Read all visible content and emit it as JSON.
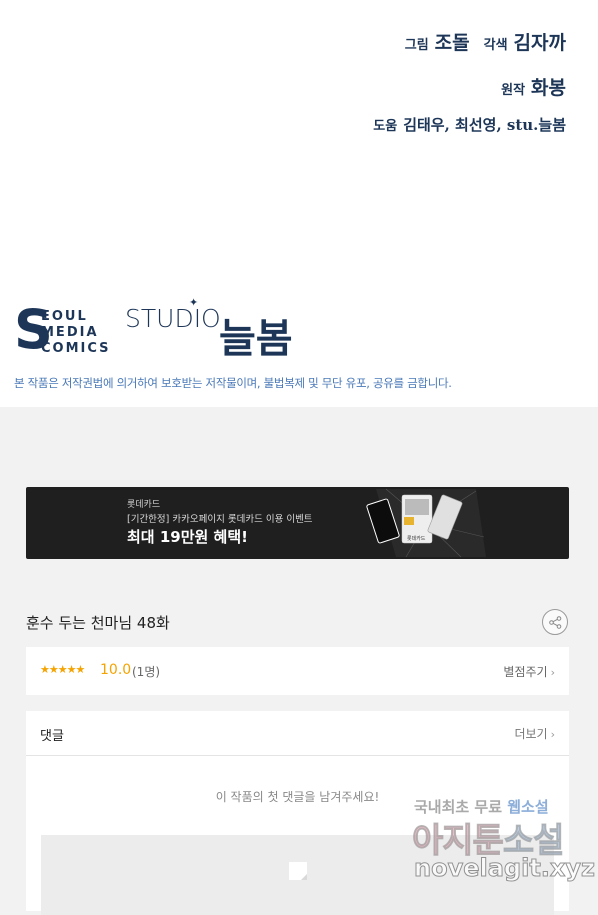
{
  "credits": {
    "art_role": "그림",
    "art_name": "조돌",
    "color_role": "각색",
    "color_name": "김자까",
    "original_role": "원작",
    "original_name": "화봉",
    "assist_role": "도움",
    "assist_names": "김태우, 최선영, stu.늘봄"
  },
  "logos": {
    "seoul_big": "S",
    "seoul_row1": "EOUL",
    "seoul_row2": "MEDIA",
    "seoul_row3": "COMICS",
    "studio_text": "STUDIO",
    "studio_name": "늘봄"
  },
  "copyright": "본 작품은 저작권법에 의거하여 보호받는 저작물이며, 불법복제 및 무단 유포, 공유를 금합니다.",
  "banner": {
    "line1": "롯데카드",
    "line2": "[기간한정] 카카오페이지 롯데카드 이용 이벤트",
    "line3": "최대 19만원 혜택!",
    "card_label": "롯데카드"
  },
  "episode": {
    "title": "훈수 두는 천마님 48화"
  },
  "rating": {
    "stars": "★★★★★",
    "score": "10.0",
    "count": "(1명)",
    "rate_label": "별점주기"
  },
  "comments": {
    "header": "댓글",
    "more_label": "더보기",
    "empty_text": "이 작품의 첫 댓글을 남겨주세요!"
  },
  "watermark": {
    "line1_prefix": "국내최초 무료 ",
    "line1_highlight": "웹소설",
    "line2_prefix": "아지툰",
    "line2_highlight": "소설",
    "line3": "novelagit.xyz"
  },
  "colors": {
    "brand_navy": "#1d3658",
    "copyright_blue": "#4a79b8",
    "rating_orange": "#f5a300"
  }
}
